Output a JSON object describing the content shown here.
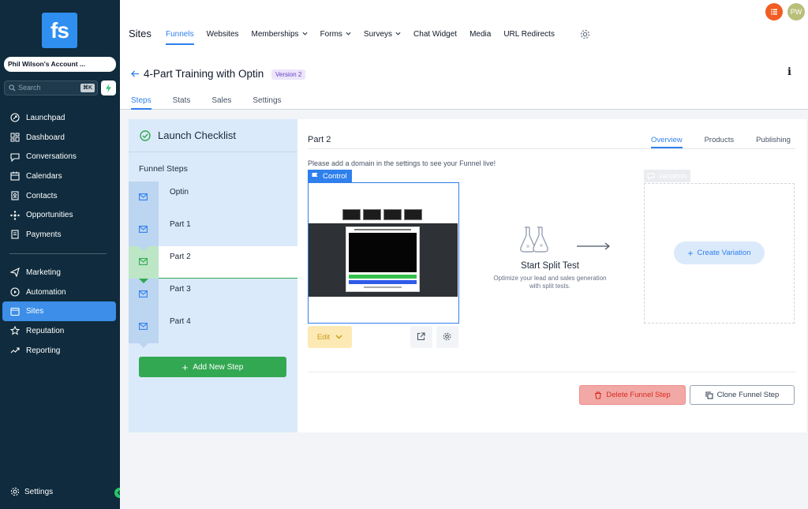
{
  "sidebar": {
    "logo": "fs",
    "account": "Phil Wilson's Account ...",
    "search_placeholder": "Search",
    "search_shortcut": "⌘K",
    "items": [
      {
        "label": "Launchpad",
        "icon": "launchpad-icon"
      },
      {
        "label": "Dashboard",
        "icon": "dashboard-icon"
      },
      {
        "label": "Conversations",
        "icon": "conversations-icon"
      },
      {
        "label": "Calendars",
        "icon": "calendar-icon"
      },
      {
        "label": "Contacts",
        "icon": "contacts-icon"
      },
      {
        "label": "Opportunities",
        "icon": "opportunities-icon"
      },
      {
        "label": "Payments",
        "icon": "payments-icon"
      }
    ],
    "items2": [
      {
        "label": "Marketing",
        "icon": "marketing-icon"
      },
      {
        "label": "Automation",
        "icon": "automation-icon"
      },
      {
        "label": "Sites",
        "icon": "sites-icon",
        "active": true
      },
      {
        "label": "Reputation",
        "icon": "reputation-icon"
      },
      {
        "label": "Reporting",
        "icon": "reporting-icon"
      }
    ],
    "settings": "Settings"
  },
  "topbar": {
    "title": "Sites",
    "tabs": [
      "Funnels",
      "Websites",
      "Memberships",
      "Forms",
      "Surveys",
      "Chat Widget",
      "Media",
      "URL Redirects"
    ],
    "active_tab": "Funnels",
    "avatar_initials": "PW",
    "colors": {
      "accent": "#2f80ed",
      "notification": "#f15d22",
      "avatar": "#b9bf79"
    }
  },
  "funnel": {
    "title": "4-Part Training with Optin",
    "version": "Version 2",
    "subtabs": [
      "Steps",
      "Stats",
      "Sales",
      "Settings"
    ],
    "active_subtab": "Steps"
  },
  "left": {
    "checklist": "Launch Checklist",
    "steps_label": "Funnel Steps",
    "steps": [
      "Optin",
      "Part 1",
      "Part 2",
      "Part 3",
      "Part 4"
    ],
    "active_step": "Part 2",
    "add_step": "Add New Step"
  },
  "right": {
    "title": "Part 2",
    "tabs": [
      "Overview",
      "Products",
      "Publishing"
    ],
    "active_tab": "Overview",
    "notice": "Please add a domain in the settings to see your Funnel live!",
    "control_label": "Control",
    "edit_label": "Edit",
    "split_title": "Start Split Test",
    "split_desc1": "Optimize your lead and sales generation",
    "split_desc2": "with split tests.",
    "variation_label": "Variation",
    "create_variation": "Create Variation",
    "delete_step": "Delete Funnel Step",
    "clone_step": "Clone Funnel Step"
  }
}
